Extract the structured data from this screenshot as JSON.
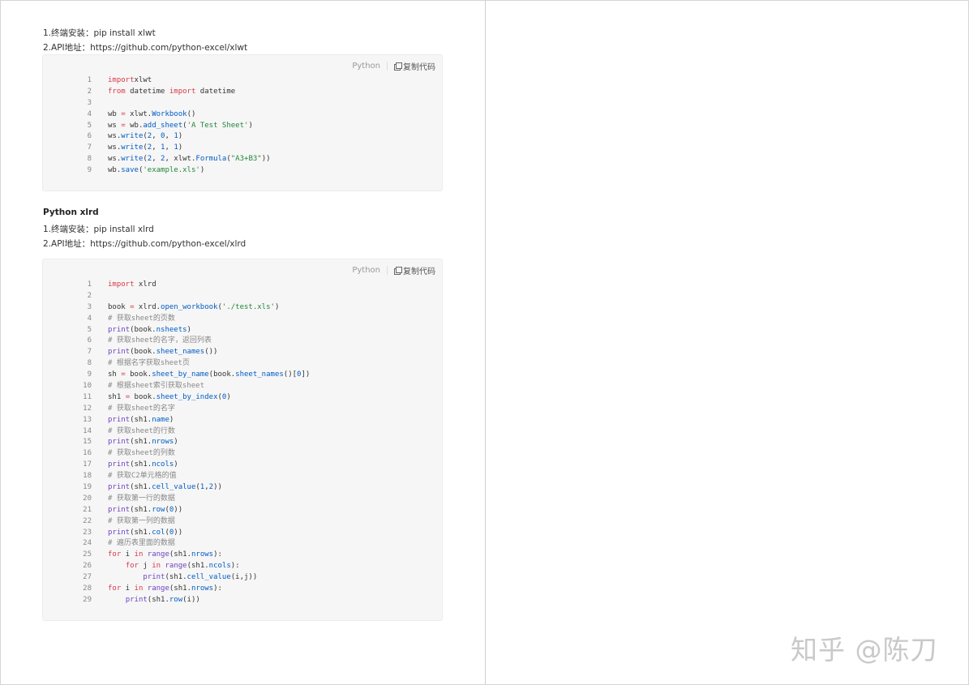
{
  "xlwt": {
    "install": "1.终端安装：pip install xlwt",
    "api": "2.API地址：https://github.com/python-excel/xlwt",
    "code_lang": "Python",
    "copy_label": "复制代码",
    "code": [
      [
        [
          "kw",
          "import"
        ],
        [
          "",
          "xlwt"
        ]
      ],
      [
        [
          "kw",
          "from"
        ],
        [
          "",
          " datetime "
        ],
        [
          "kw",
          "import"
        ],
        [
          "",
          " datetime"
        ]
      ],
      [],
      [
        [
          "",
          "wb "
        ],
        [
          "kw",
          "="
        ],
        [
          "",
          " xlwt."
        ],
        [
          "fn",
          "Workbook"
        ],
        [
          "",
          "()"
        ]
      ],
      [
        [
          "",
          "ws "
        ],
        [
          "kw",
          "="
        ],
        [
          "",
          " wb."
        ],
        [
          "fn",
          "add_sheet"
        ],
        [
          "",
          "("
        ],
        [
          "str",
          "'A Test Sheet'"
        ],
        [
          "",
          ")"
        ]
      ],
      [
        [
          "",
          "ws."
        ],
        [
          "fn",
          "write"
        ],
        [
          "",
          "("
        ],
        [
          "fn",
          "2"
        ],
        [
          "",
          ", "
        ],
        [
          "fn",
          "0"
        ],
        [
          "",
          ", "
        ],
        [
          "fn",
          "1"
        ],
        [
          "",
          ")"
        ]
      ],
      [
        [
          "",
          "ws."
        ],
        [
          "fn",
          "write"
        ],
        [
          "",
          "("
        ],
        [
          "fn",
          "2"
        ],
        [
          "",
          ", "
        ],
        [
          "fn",
          "1"
        ],
        [
          "",
          ", "
        ],
        [
          "fn",
          "1"
        ],
        [
          "",
          ")"
        ]
      ],
      [
        [
          "",
          "ws."
        ],
        [
          "fn",
          "write"
        ],
        [
          "",
          "("
        ],
        [
          "fn",
          "2"
        ],
        [
          "",
          ", "
        ],
        [
          "fn",
          "2"
        ],
        [
          "",
          ", xlwt."
        ],
        [
          "fn",
          "Formula"
        ],
        [
          "",
          "("
        ],
        [
          "str",
          "\"A3+B3\""
        ],
        [
          "",
          "))"
        ]
      ],
      [
        [
          "",
          "wb."
        ],
        [
          "fn",
          "save"
        ],
        [
          "",
          "("
        ],
        [
          "str",
          "'example.xls'"
        ],
        [
          "",
          ")"
        ]
      ]
    ]
  },
  "xlrd": {
    "heading": "Python xlrd",
    "install": "1.终端安装：pip install xlrd",
    "api": "2.API地址：https://github.com/python-excel/xlrd",
    "code_lang": "Python",
    "copy_label": "复制代码",
    "code": [
      [
        [
          "kw",
          "import"
        ],
        [
          "",
          " xlrd"
        ]
      ],
      [],
      [
        [
          "",
          "book "
        ],
        [
          "kw",
          "="
        ],
        [
          "",
          " xlrd."
        ],
        [
          "fn",
          "open_workbook"
        ],
        [
          "",
          "("
        ],
        [
          "str",
          "'./test.xls'"
        ],
        [
          "",
          ")"
        ]
      ],
      [
        [
          "cm",
          "# 获取sheet的页数"
        ]
      ],
      [
        [
          "bi",
          "print"
        ],
        [
          "",
          "(book."
        ],
        [
          "fn",
          "nsheets"
        ],
        [
          "",
          ")"
        ]
      ],
      [
        [
          "cm",
          "# 获取sheet的名字，返回列表"
        ]
      ],
      [
        [
          "bi",
          "print"
        ],
        [
          "",
          "(book."
        ],
        [
          "fn",
          "sheet_names"
        ],
        [
          "",
          "())"
        ]
      ],
      [
        [
          "cm",
          "# 根据名字获取sheet页"
        ]
      ],
      [
        [
          "",
          "sh "
        ],
        [
          "kw",
          "="
        ],
        [
          "",
          " book."
        ],
        [
          "fn",
          "sheet_by_name"
        ],
        [
          "",
          "(book."
        ],
        [
          "fn",
          "sheet_names"
        ],
        [
          "",
          "()["
        ],
        [
          "fn",
          "0"
        ],
        [
          "",
          "])"
        ]
      ],
      [
        [
          "cm",
          "# 根据sheet索引获取sheet"
        ]
      ],
      [
        [
          "",
          "sh1 "
        ],
        [
          "kw",
          "="
        ],
        [
          "",
          " book."
        ],
        [
          "fn",
          "sheet_by_index"
        ],
        [
          "",
          "("
        ],
        [
          "fn",
          "0"
        ],
        [
          "",
          ")"
        ]
      ],
      [
        [
          "cm",
          "# 获取sheet的名字"
        ]
      ],
      [
        [
          "bi",
          "print"
        ],
        [
          "",
          "(sh1."
        ],
        [
          "fn",
          "name"
        ],
        [
          "",
          ")"
        ]
      ],
      [
        [
          "cm",
          "# 获取sheet的行数"
        ]
      ],
      [
        [
          "bi",
          "print"
        ],
        [
          "",
          "(sh1."
        ],
        [
          "fn",
          "nrows"
        ],
        [
          "",
          ")"
        ]
      ],
      [
        [
          "cm",
          "# 获取sheet的列数"
        ]
      ],
      [
        [
          "bi",
          "print"
        ],
        [
          "",
          "(sh1."
        ],
        [
          "fn",
          "ncols"
        ],
        [
          "",
          ")"
        ]
      ],
      [
        [
          "cm",
          "# 获取C2单元格的值"
        ]
      ],
      [
        [
          "bi",
          "print"
        ],
        [
          "",
          "(sh1."
        ],
        [
          "fn",
          "cell_value"
        ],
        [
          "",
          "("
        ],
        [
          "fn",
          "1"
        ],
        [
          "",
          ","
        ],
        [
          "fn",
          "2"
        ],
        [
          "",
          "))"
        ]
      ],
      [
        [
          "cm",
          "# 获取第一行的数据"
        ]
      ],
      [
        [
          "bi",
          "print"
        ],
        [
          "",
          "(sh1."
        ],
        [
          "fn",
          "row"
        ],
        [
          "",
          "("
        ],
        [
          "fn",
          "0"
        ],
        [
          "",
          "))"
        ]
      ],
      [
        [
          "cm",
          "# 获取第一列的数据"
        ]
      ],
      [
        [
          "bi",
          "print"
        ],
        [
          "",
          "(sh1."
        ],
        [
          "fn",
          "col"
        ],
        [
          "",
          "("
        ],
        [
          "fn",
          "0"
        ],
        [
          "",
          "))"
        ]
      ],
      [
        [
          "cm",
          "# 遍历表里面的数据"
        ]
      ],
      [
        [
          "kw",
          "for"
        ],
        [
          "",
          " i "
        ],
        [
          "kw",
          "in"
        ],
        [
          "",
          " "
        ],
        [
          "bi",
          "range"
        ],
        [
          "",
          "(sh1."
        ],
        [
          "fn",
          "nrows"
        ],
        [
          "",
          "):"
        ]
      ],
      [
        [
          "",
          "    "
        ],
        [
          "kw",
          "for"
        ],
        [
          "",
          " j "
        ],
        [
          "kw",
          "in"
        ],
        [
          "",
          " "
        ],
        [
          "bi",
          "range"
        ],
        [
          "",
          "(sh1."
        ],
        [
          "fn",
          "ncols"
        ],
        [
          "",
          "):"
        ]
      ],
      [
        [
          "",
          "        "
        ],
        [
          "bi",
          "print"
        ],
        [
          "",
          "(sh1."
        ],
        [
          "fn",
          "cell_value"
        ],
        [
          "",
          "(i,j))"
        ]
      ],
      [
        [
          "kw",
          "for"
        ],
        [
          "",
          " i "
        ],
        [
          "kw",
          "in"
        ],
        [
          "",
          " "
        ],
        [
          "bi",
          "range"
        ],
        [
          "",
          "(sh1."
        ],
        [
          "fn",
          "nrows"
        ],
        [
          "",
          "):"
        ]
      ],
      [
        [
          "",
          "    "
        ],
        [
          "bi",
          "print"
        ],
        [
          "",
          "(sh1."
        ],
        [
          "fn",
          "row"
        ],
        [
          "",
          "(i))"
        ]
      ]
    ]
  },
  "watermark": "知乎 @陈刀"
}
